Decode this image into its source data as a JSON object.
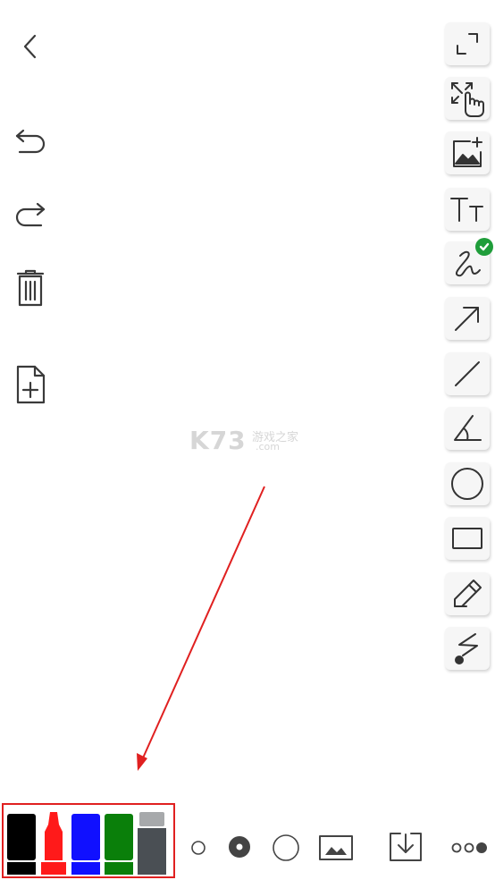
{
  "watermark": {
    "main": "K73",
    "sub": "游戏之家",
    "domain": ".com"
  },
  "left_toolbar": [
    "back-icon",
    "undo-icon",
    "redo-icon",
    "trash-icon",
    "new-page-icon"
  ],
  "right_toolbar": [
    "fullscreen-icon",
    "pan-zoom-icon",
    "insert-image-icon",
    "text-icon",
    "freehand-pen-icon",
    "arrow-icon",
    "line-icon",
    "angle-icon",
    "circle-icon",
    "rectangle-icon",
    "pencil-icon",
    "laser-pointer-icon"
  ],
  "active_tool": "freehand-pen-icon",
  "palette": {
    "markers": [
      {
        "name": "black-marker",
        "color": "#000000"
      },
      {
        "name": "red-marker",
        "color": "#ff1a1a"
      },
      {
        "name": "blue-marker",
        "color": "#1010ff"
      },
      {
        "name": "green-marker",
        "color": "#0a7f0a"
      },
      {
        "name": "eraser-marker",
        "color": "#4a4f54"
      }
    ],
    "highlight_color": "#e02020"
  },
  "bottom_toolbar": [
    "small-brush-icon",
    "medium-brush-icon",
    "large-brush-icon",
    "background-image-icon",
    "save-icon",
    "more-icon"
  ],
  "selected_brush": "medium-brush-icon",
  "annotation_arrow_color": "#e02020"
}
